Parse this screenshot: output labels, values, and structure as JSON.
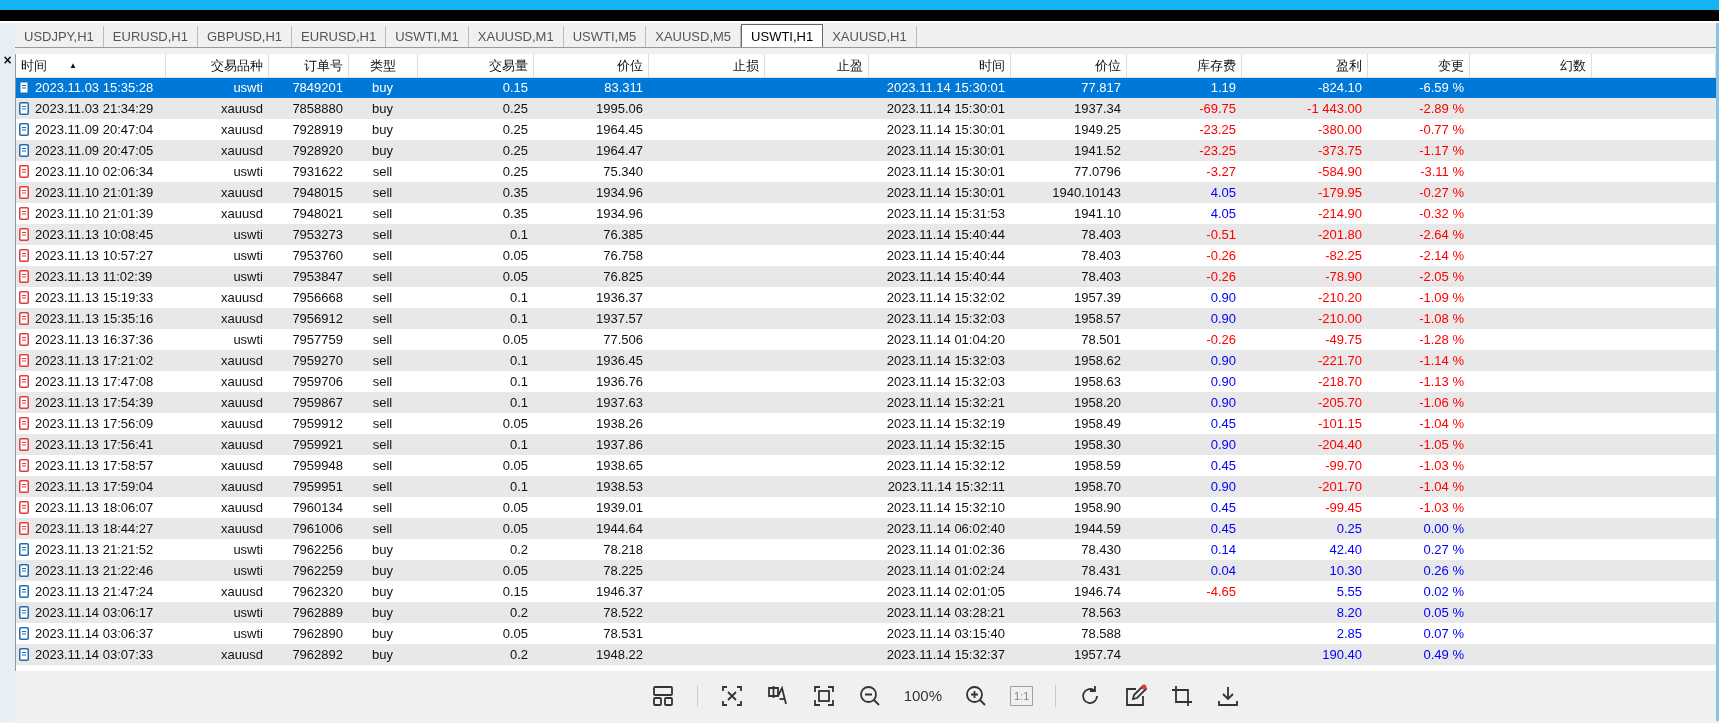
{
  "tabs": [
    {
      "label": "USDJPY,H1",
      "selected": false
    },
    {
      "label": "EURUSD,H1",
      "selected": false
    },
    {
      "label": "GBPUSD,H1",
      "selected": false
    },
    {
      "label": "EURUSD,H1",
      "selected": false
    },
    {
      "label": "USWTI,M1",
      "selected": false
    },
    {
      "label": "XAUUSD,M1",
      "selected": false
    },
    {
      "label": "USWTI,M5",
      "selected": false
    },
    {
      "label": "XAUUSD,M5",
      "selected": false
    },
    {
      "label": "USWTI,H1",
      "selected": true
    },
    {
      "label": "XAUUSD,H1",
      "selected": false
    }
  ],
  "close_glyph": "×",
  "table": {
    "columns": [
      {
        "label": "时间",
        "sort": "▲"
      },
      {
        "label": "交易品种"
      },
      {
        "label": "订单号"
      },
      {
        "label": "类型"
      },
      {
        "label": "交易量"
      },
      {
        "label": "价位"
      },
      {
        "label": "止损"
      },
      {
        "label": "止盈"
      },
      {
        "label": "时间"
      },
      {
        "label": "价位"
      },
      {
        "label": "库存费"
      },
      {
        "label": "盈利"
      },
      {
        "label": "变更"
      },
      {
        "label": "幻数"
      }
    ],
    "rows": [
      {
        "color": "#1f6fb2",
        "selected": true,
        "cells": [
          "2023.11.03 15:35:28",
          "uswti",
          "7849201",
          "buy",
          "0.15",
          "83.311",
          "",
          "",
          "2023.11.14 15:30:01",
          "77.817",
          "1.19",
          "-824.10",
          "-6.59 %"
        ],
        "swap_loss": false,
        "loss": true
      },
      {
        "color": "#1f6fb2",
        "selected": false,
        "cells": [
          "2023.11.03 21:34:29",
          "xauusd",
          "7858880",
          "buy",
          "0.25",
          "1995.06",
          "",
          "",
          "2023.11.14 15:30:01",
          "1937.34",
          "-69.75",
          "-1 443.00",
          "-2.89 %"
        ],
        "swap_loss": true,
        "loss": true
      },
      {
        "color": "#1f6fb2",
        "selected": false,
        "cells": [
          "2023.11.09 20:47:04",
          "xauusd",
          "7928919",
          "buy",
          "0.25",
          "1964.45",
          "",
          "",
          "2023.11.14 15:30:01",
          "1949.25",
          "-23.25",
          "-380.00",
          "-0.77 %"
        ],
        "swap_loss": true,
        "loss": true
      },
      {
        "color": "#1f6fb2",
        "selected": false,
        "cells": [
          "2023.11.09 20:47:05",
          "xauusd",
          "7928920",
          "buy",
          "0.25",
          "1964.47",
          "",
          "",
          "2023.11.14 15:30:01",
          "1941.52",
          "-23.25",
          "-373.75",
          "-1.17 %"
        ],
        "swap_loss": true,
        "loss": true
      },
      {
        "color": "#e03c3c",
        "selected": false,
        "cells": [
          "2023.11.10 02:06:34",
          "uswti",
          "7931622",
          "sell",
          "0.25",
          "75.340",
          "",
          "",
          "2023.11.14 15:30:01",
          "77.0796",
          "-3.27",
          "-584.90",
          "-3.11 %"
        ],
        "swap_loss": true,
        "loss": true
      },
      {
        "color": "#e03c3c",
        "selected": false,
        "cells": [
          "2023.11.10 21:01:39",
          "xauusd",
          "7948015",
          "sell",
          "0.35",
          "1934.96",
          "",
          "",
          "2023.11.14 15:30:01",
          "1940.10143",
          "4.05",
          "-179.95",
          "-0.27 %"
        ],
        "swap_loss": false,
        "loss": true
      },
      {
        "color": "#e03c3c",
        "selected": false,
        "cells": [
          "2023.11.10 21:01:39",
          "xauusd",
          "7948021",
          "sell",
          "0.35",
          "1934.96",
          "",
          "",
          "2023.11.14 15:31:53",
          "1941.10",
          "4.05",
          "-214.90",
          "-0.32 %"
        ],
        "swap_loss": false,
        "loss": true
      },
      {
        "color": "#e03c3c",
        "selected": false,
        "cells": [
          "2023.11.13 10:08:45",
          "uswti",
          "7953273",
          "sell",
          "0.1",
          "76.385",
          "",
          "",
          "2023.11.14 15:40:44",
          "78.403",
          "-0.51",
          "-201.80",
          "-2.64 %"
        ],
        "swap_loss": true,
        "loss": true
      },
      {
        "color": "#e03c3c",
        "selected": false,
        "cells": [
          "2023.11.13 10:57:27",
          "uswti",
          "7953760",
          "sell",
          "0.05",
          "76.758",
          "",
          "",
          "2023.11.14 15:40:44",
          "78.403",
          "-0.26",
          "-82.25",
          "-2.14 %"
        ],
        "swap_loss": true,
        "loss": true
      },
      {
        "color": "#e03c3c",
        "selected": false,
        "cells": [
          "2023.11.13 11:02:39",
          "uswti",
          "7953847",
          "sell",
          "0.05",
          "76.825",
          "",
          "",
          "2023.11.14 15:40:44",
          "78.403",
          "-0.26",
          "-78.90",
          "-2.05 %"
        ],
        "swap_loss": true,
        "loss": true
      },
      {
        "color": "#e03c3c",
        "selected": false,
        "cells": [
          "2023.11.13 15:19:33",
          "xauusd",
          "7956668",
          "sell",
          "0.1",
          "1936.37",
          "",
          "",
          "2023.11.14 15:32:02",
          "1957.39",
          "0.90",
          "-210.20",
          "-1.09 %"
        ],
        "swap_loss": false,
        "loss": true
      },
      {
        "color": "#e03c3c",
        "selected": false,
        "cells": [
          "2023.11.13 15:35:16",
          "xauusd",
          "7956912",
          "sell",
          "0.1",
          "1937.57",
          "",
          "",
          "2023.11.14 15:32:03",
          "1958.57",
          "0.90",
          "-210.00",
          "-1.08 %"
        ],
        "swap_loss": false,
        "loss": true
      },
      {
        "color": "#e03c3c",
        "selected": false,
        "cells": [
          "2023.11.13 16:37:36",
          "uswti",
          "7957759",
          "sell",
          "0.05",
          "77.506",
          "",
          "",
          "2023.11.14 01:04:20",
          "78.501",
          "-0.26",
          "-49.75",
          "-1.28 %"
        ],
        "swap_loss": true,
        "loss": true
      },
      {
        "color": "#e03c3c",
        "selected": false,
        "cells": [
          "2023.11.13 17:21:02",
          "xauusd",
          "7959270",
          "sell",
          "0.1",
          "1936.45",
          "",
          "",
          "2023.11.14 15:32:03",
          "1958.62",
          "0.90",
          "-221.70",
          "-1.14 %"
        ],
        "swap_loss": false,
        "loss": true
      },
      {
        "color": "#e03c3c",
        "selected": false,
        "cells": [
          "2023.11.13 17:47:08",
          "xauusd",
          "7959706",
          "sell",
          "0.1",
          "1936.76",
          "",
          "",
          "2023.11.14 15:32:03",
          "1958.63",
          "0.90",
          "-218.70",
          "-1.13 %"
        ],
        "swap_loss": false,
        "loss": true
      },
      {
        "color": "#e03c3c",
        "selected": false,
        "cells": [
          "2023.11.13 17:54:39",
          "xauusd",
          "7959867",
          "sell",
          "0.1",
          "1937.63",
          "",
          "",
          "2023.11.14 15:32:21",
          "1958.20",
          "0.90",
          "-205.70",
          "-1.06 %"
        ],
        "swap_loss": false,
        "loss": true
      },
      {
        "color": "#e03c3c",
        "selected": false,
        "cells": [
          "2023.11.13 17:56:09",
          "xauusd",
          "7959912",
          "sell",
          "0.05",
          "1938.26",
          "",
          "",
          "2023.11.14 15:32:19",
          "1958.49",
          "0.45",
          "-101.15",
          "-1.04 %"
        ],
        "swap_loss": false,
        "loss": true
      },
      {
        "color": "#e03c3c",
        "selected": false,
        "cells": [
          "2023.11.13 17:56:41",
          "xauusd",
          "7959921",
          "sell",
          "0.1",
          "1937.86",
          "",
          "",
          "2023.11.14 15:32:15",
          "1958.30",
          "0.90",
          "-204.40",
          "-1.05 %"
        ],
        "swap_loss": false,
        "loss": true
      },
      {
        "color": "#e03c3c",
        "selected": false,
        "cells": [
          "2023.11.13 17:58:57",
          "xauusd",
          "7959948",
          "sell",
          "0.05",
          "1938.65",
          "",
          "",
          "2023.11.14 15:32:12",
          "1958.59",
          "0.45",
          "-99.70",
          "-1.03 %"
        ],
        "swap_loss": false,
        "loss": true
      },
      {
        "color": "#e03c3c",
        "selected": false,
        "cells": [
          "2023.11.13 17:59:04",
          "xauusd",
          "7959951",
          "sell",
          "0.1",
          "1938.53",
          "",
          "",
          "2023.11.14 15:32:11",
          "1958.70",
          "0.90",
          "-201.70",
          "-1.04 %"
        ],
        "swap_loss": false,
        "loss": true
      },
      {
        "color": "#e03c3c",
        "selected": false,
        "cells": [
          "2023.11.13 18:06:07",
          "xauusd",
          "7960134",
          "sell",
          "0.05",
          "1939.01",
          "",
          "",
          "2023.11.14 15:32:10",
          "1958.90",
          "0.45",
          "-99.45",
          "-1.03 %"
        ],
        "swap_loss": false,
        "loss": true
      },
      {
        "color": "#e03c3c",
        "selected": false,
        "cells": [
          "2023.11.13 18:44:27",
          "xauusd",
          "7961006",
          "sell",
          "0.05",
          "1944.64",
          "",
          "",
          "2023.11.14 06:02:40",
          "1944.59",
          "0.45",
          "0.25",
          "0.00 %"
        ],
        "swap_loss": false,
        "loss": false
      },
      {
        "color": "#1f6fb2",
        "selected": false,
        "cells": [
          "2023.11.13 21:21:52",
          "uswti",
          "7962256",
          "buy",
          "0.2",
          "78.218",
          "",
          "",
          "2023.11.14 01:02:36",
          "78.430",
          "0.14",
          "42.40",
          "0.27 %"
        ],
        "swap_loss": false,
        "loss": false
      },
      {
        "color": "#1f6fb2",
        "selected": false,
        "cells": [
          "2023.11.13 21:22:46",
          "uswti",
          "7962259",
          "buy",
          "0.05",
          "78.225",
          "",
          "",
          "2023.11.14 01:02:24",
          "78.431",
          "0.04",
          "10.30",
          "0.26 %"
        ],
        "swap_loss": false,
        "loss": false
      },
      {
        "color": "#1f6fb2",
        "selected": false,
        "cells": [
          "2023.11.13 21:47:24",
          "xauusd",
          "7962320",
          "buy",
          "0.15",
          "1946.37",
          "",
          "",
          "2023.11.14 02:01:05",
          "1946.74",
          "-4.65",
          "5.55",
          "0.02 %"
        ],
        "swap_loss": true,
        "loss": false
      },
      {
        "color": "#1f6fb2",
        "selected": false,
        "cells": [
          "2023.11.14 03:06:17",
          "uswti",
          "7962889",
          "buy",
          "0.2",
          "78.522",
          "",
          "",
          "2023.11.14 03:28:21",
          "78.563",
          "",
          "8.20",
          "0.05 %"
        ],
        "loss": false
      },
      {
        "color": "#1f6fb2",
        "selected": false,
        "cells": [
          "2023.11.14 03:06:37",
          "uswti",
          "7962890",
          "buy",
          "0.05",
          "78.531",
          "",
          "",
          "2023.11.14 03:15:40",
          "78.588",
          "",
          "2.85",
          "0.07 %"
        ],
        "loss": false
      },
      {
        "color": "#1f6fb2",
        "selected": false,
        "cells": [
          "2023.11.14 03:07:33",
          "xauusd",
          "7962892",
          "buy",
          "0.2",
          "1948.22",
          "",
          "",
          "2023.11.14 15:32:37",
          "1957.74",
          "",
          "190.40",
          "0.49 %"
        ],
        "loss": false
      }
    ]
  },
  "viewer_toolbar": {
    "zoom_label": "100%",
    "actual_size_label": "1:1",
    "actual_size_disabled": true
  }
}
